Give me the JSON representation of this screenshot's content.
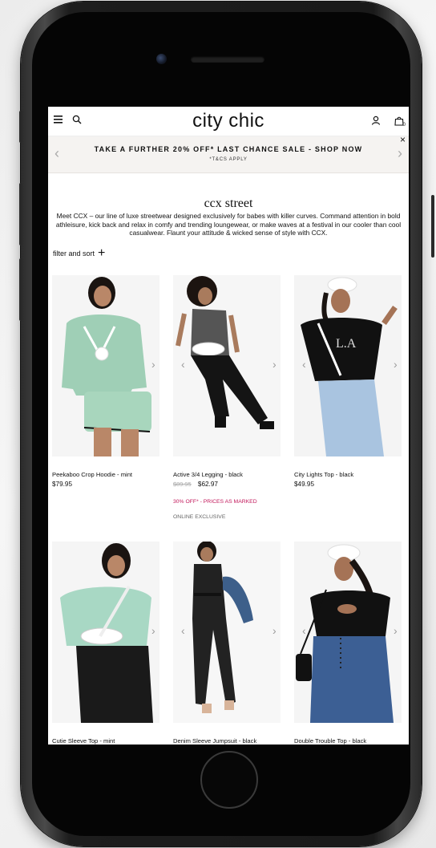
{
  "app": {
    "brand": "city chic"
  },
  "header": {
    "menu_icon": "hamburger-menu-icon",
    "search_icon": "search-icon",
    "account_icon": "user-icon",
    "bag_icon": "shopping-bag-icon",
    "bag_count": "0"
  },
  "promo_banner": {
    "text": "TAKE A FURTHER 20% OFF* LAST CHANCE SALE - SHOP NOW",
    "subtext": "*T&CS APPLY",
    "prev_icon": "chevron-left-icon",
    "next_icon": "chevron-right-icon",
    "close_label": "×"
  },
  "category": {
    "title": "ccx street",
    "description": "Meet CCX – our line of luxe streetwear designed exclusively for babes with killer curves. Command attention in bold athleisure, kick back and relax in comfy and trending loungewear, or make waves at a festival in our cooler than cool casualwear. Flaunt your attitude & wicked sense of style with CCX."
  },
  "filter": {
    "label": "filter and sort",
    "icon": "plus-icon"
  },
  "products": [
    {
      "name": "Peekaboo Crop Hoodie - mint",
      "price": "$79.95",
      "original_price": "",
      "promo": "",
      "badge": ""
    },
    {
      "name": "Active 3/4 Legging - black",
      "price": "$62.97",
      "original_price": "$89.95",
      "promo": "30% OFF* - PRICES AS MARKED",
      "badge": "ONLINE EXCLUSIVE"
    },
    {
      "name": "City Lights Top - black",
      "price": "$49.95",
      "original_price": "",
      "promo": "",
      "badge": ""
    },
    {
      "name": "Cutie Sleeve Top - mint",
      "price": "",
      "original_price": "",
      "promo": "",
      "badge": ""
    },
    {
      "name": "Denim Sleeve Jumpsuit - black",
      "price": "",
      "original_price": "",
      "promo": "",
      "badge": ""
    },
    {
      "name": "Double Trouble Top - black",
      "price": "",
      "original_price": "",
      "promo": "",
      "badge": ""
    }
  ],
  "colors": {
    "accent_promo": "#c2185b",
    "banner_bg": "#f5f3f1"
  }
}
